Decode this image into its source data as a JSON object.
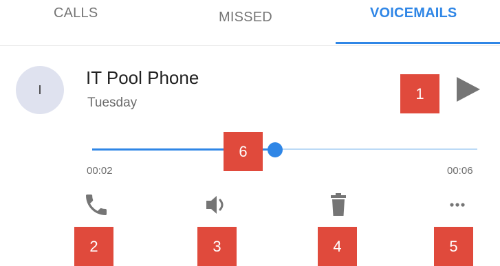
{
  "tabs": {
    "calls": "CALLS",
    "missed": "MISSED",
    "voicemails": "VOICEMAILS",
    "active": "voicemails",
    "accent_color": "#2f86e6"
  },
  "voicemail": {
    "avatar_initial": "I",
    "caller_name": "IT Pool Phone",
    "date": "Tuesday",
    "play_icon": "play-icon"
  },
  "player": {
    "elapsed": "00:02",
    "total": "00:06",
    "progress_fraction": 0.475
  },
  "actions": [
    {
      "name": "call-icon"
    },
    {
      "name": "speaker-icon"
    },
    {
      "name": "trash-icon"
    },
    {
      "name": "more-icon"
    }
  ],
  "badges": {
    "b1": "1",
    "b2": "2",
    "b3": "3",
    "b4": "4",
    "b5": "5",
    "b6": "6",
    "color": "#e04a3c"
  }
}
